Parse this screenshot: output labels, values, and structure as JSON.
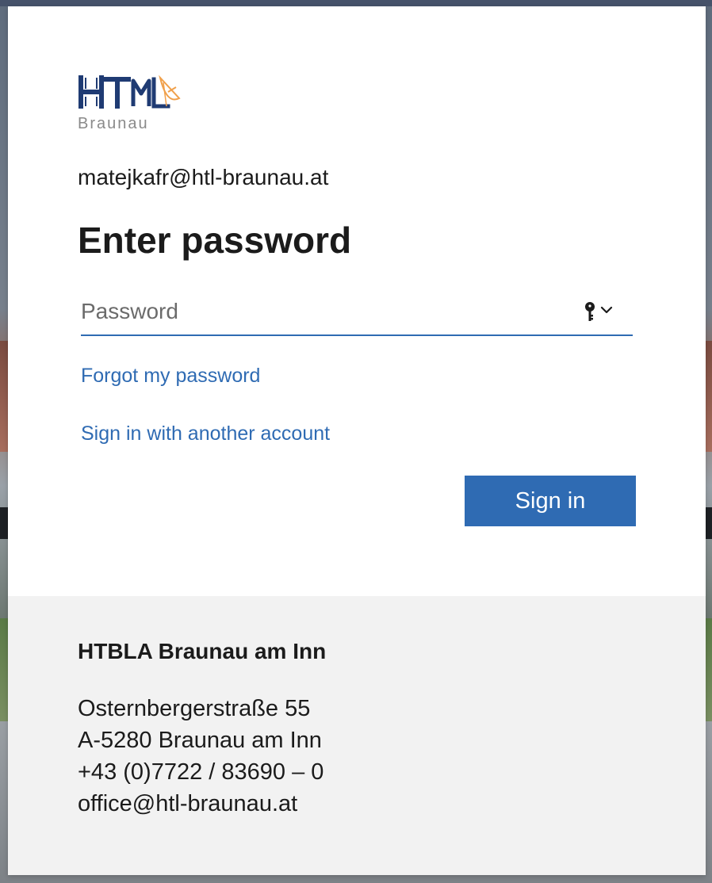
{
  "login": {
    "logo_text": "HTL",
    "logo_subtext": "Braunau",
    "username": "matejkafr@htl-braunau.at",
    "title": "Enter password",
    "password_placeholder": "Password",
    "password_value": "",
    "forgot_link": "Forgot my password",
    "other_account_link": "Sign in with another account",
    "signin_button": "Sign in"
  },
  "footer": {
    "org_name": "HTBLA Braunau am Inn",
    "address_line1": "Osternbergerstraße 55",
    "address_line2": "A-5280 Braunau am Inn",
    "phone": "+43 (0)7722 / 83690 – 0",
    "email": "office@htl-braunau.at"
  },
  "icons": {
    "password_manager": "key-icon",
    "dropdown": "chevron-down-icon"
  },
  "colors": {
    "accent": "#2f6bb3",
    "logo_navy": "#1f3b73",
    "logo_orange": "#f0a04b",
    "logo_grey": "#8a8a8a",
    "footer_bg": "#f2f2f2",
    "text": "#1b1b1b"
  }
}
